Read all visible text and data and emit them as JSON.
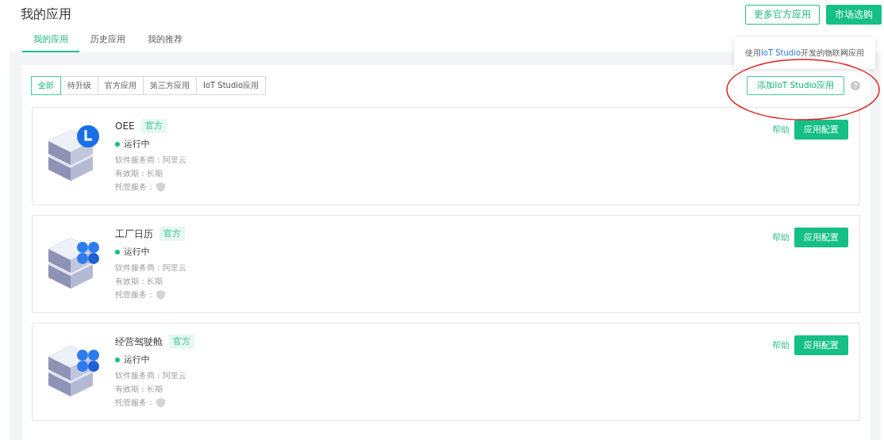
{
  "page_title": "我的应用",
  "header_buttons": [
    {
      "label": "更多官方应用",
      "kind": "outline"
    },
    {
      "label": "市场选购",
      "kind": "primary"
    }
  ],
  "tabs": [
    {
      "label": "我的应用",
      "selected": true
    },
    {
      "label": "历史应用",
      "selected": false
    },
    {
      "label": "我的推荐",
      "selected": false
    }
  ],
  "filters": [
    {
      "label": "全部",
      "selected": true
    },
    {
      "label": "待升级",
      "selected": false
    },
    {
      "label": "官方应用",
      "selected": false
    },
    {
      "label": "第三方应用",
      "selected": false
    },
    {
      "label": "IoT Studio应用",
      "selected": false
    }
  ],
  "tooltip": "使用**IoT Studio**开发的物联网应用",
  "add_button": "添加IoT Studio应用",
  "apps": [
    {
      "name": "OEE",
      "tag": "官方",
      "kind": "clock",
      "status": "运行中",
      "provider": "软件服务商：阿里云",
      "validity": "有效期：长期",
      "hosting": "托管服务：",
      "help": "帮助",
      "config": "应用配置"
    },
    {
      "name": "工厂日历",
      "tag": "官方",
      "kind": "petals",
      "status": "运行中",
      "provider": "软件服务商：阿里云",
      "validity": "有效期：长期",
      "hosting": "托管服务：",
      "help": "帮助",
      "config": "应用配置"
    },
    {
      "name": "经营驾驶舱",
      "tag": "官方",
      "kind": "petals",
      "status": "运行中",
      "provider": "软件服务商：阿里云",
      "validity": "有效期：长期",
      "hosting": "托管服务：",
      "help": "帮助",
      "config": "应用配置"
    }
  ]
}
